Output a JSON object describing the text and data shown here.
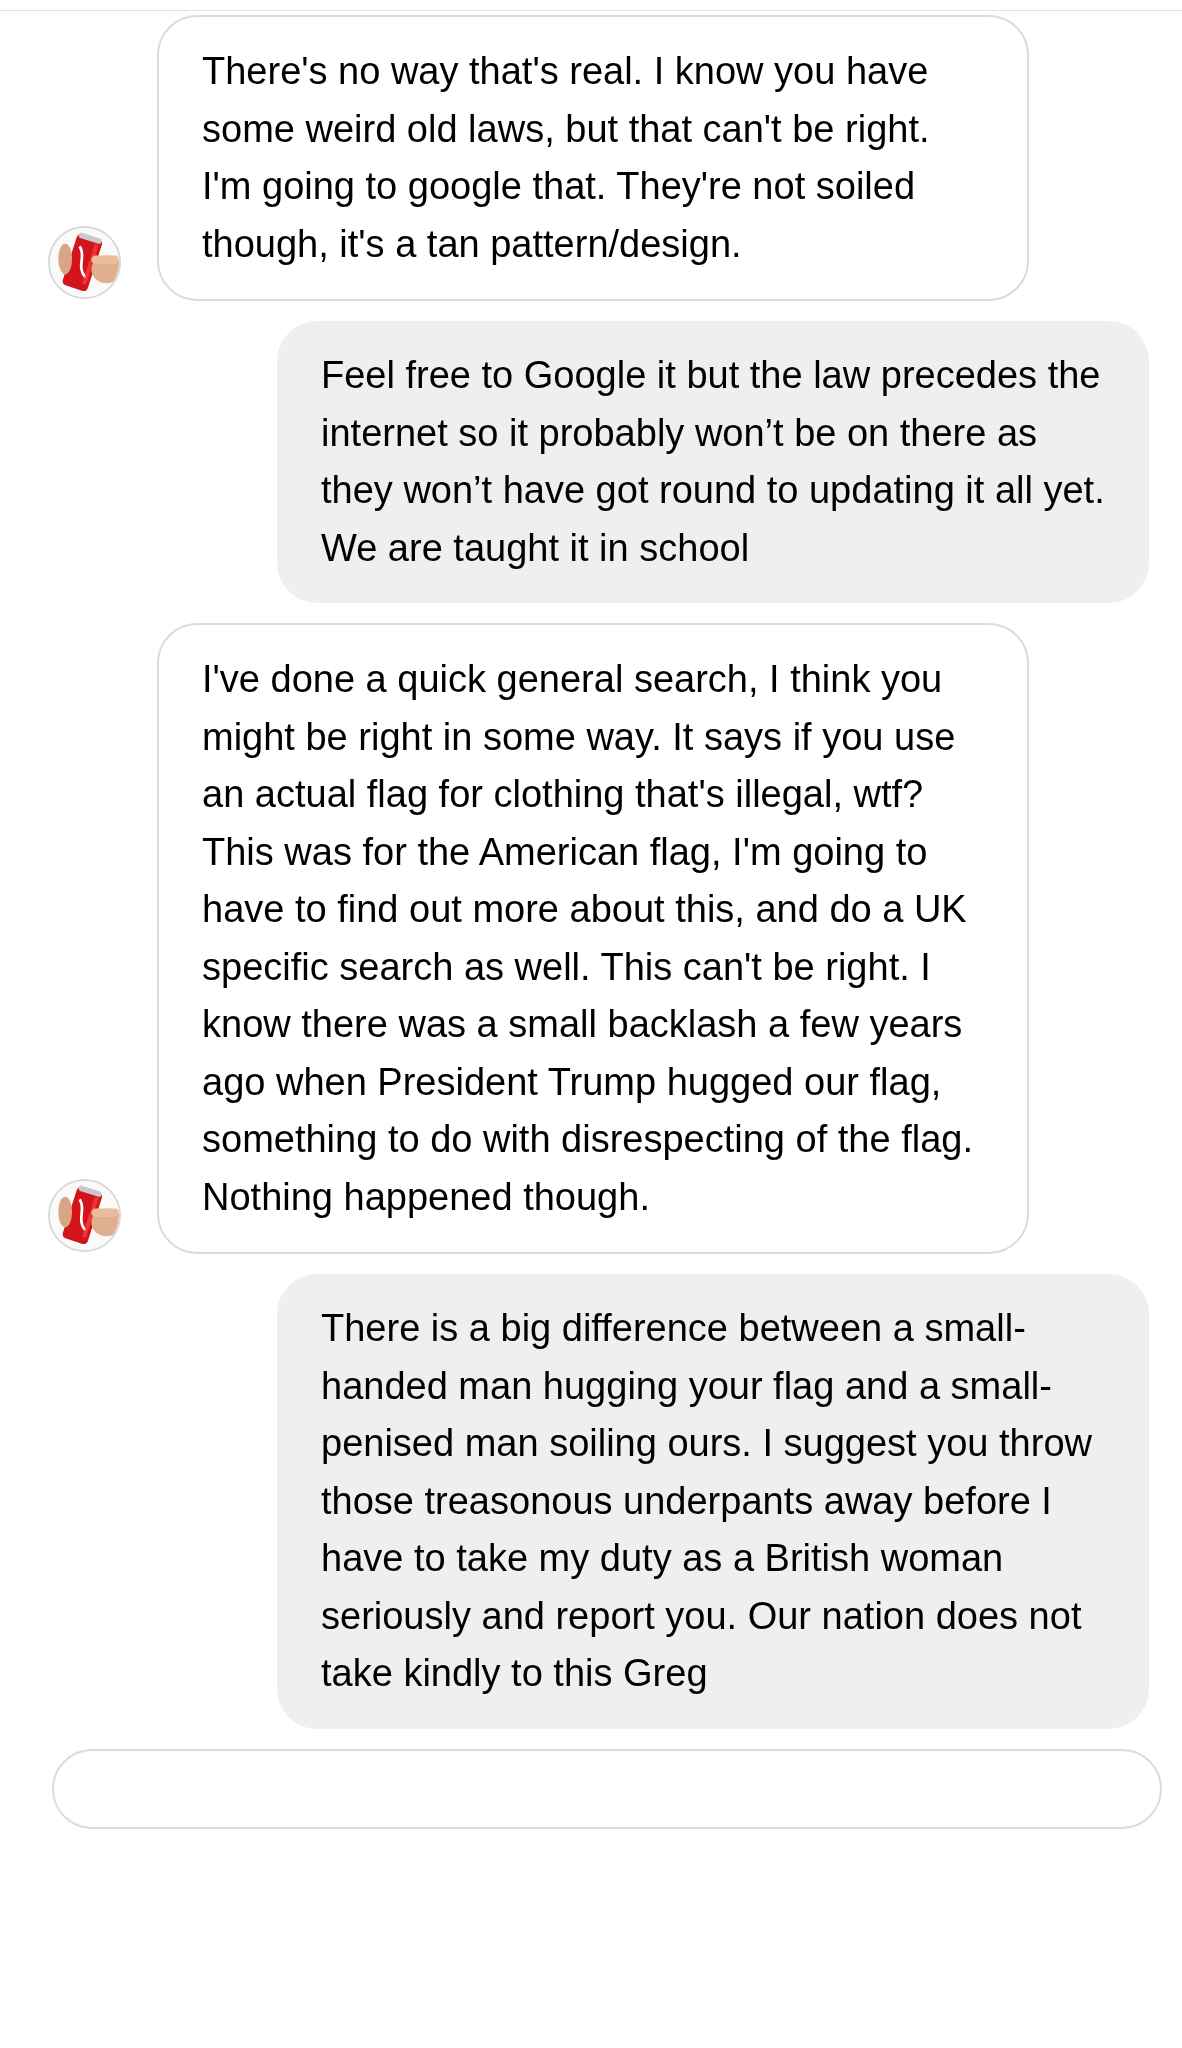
{
  "messages": [
    {
      "kind": "received",
      "text": "There's no way that's real. I know you have some weird old laws, but that can't be right. I'm going to google that. They're not soiled though, it's a tan pattern/design."
    },
    {
      "kind": "sent",
      "text": "Feel free to Google it but the law precedes the internet so it probably won’t be on there as they won’t have got round to updating it all yet. We are taught it in school"
    },
    {
      "kind": "received",
      "text": "I've done a quick general search, I think you might be right in some way. It says if you use an actual flag for clothing that's illegal, wtf? This was for the American flag, I'm going to have to find out more about this, and do a UK specific search as well. This can't be right. I know there was a small backlash a few years ago when President Trump hugged our flag, something to do with disrespecting of the flag. Nothing happened though."
    },
    {
      "kind": "sent",
      "text": "There is a big difference between a small-handed man hugging your flag and a small-penised man soiling ours. I suggest you throw those treasonous underpants away before I have to take my duty as a British woman seriously and report you. Our nation does not take kindly to this Greg"
    },
    {
      "kind": "received"
    }
  ]
}
